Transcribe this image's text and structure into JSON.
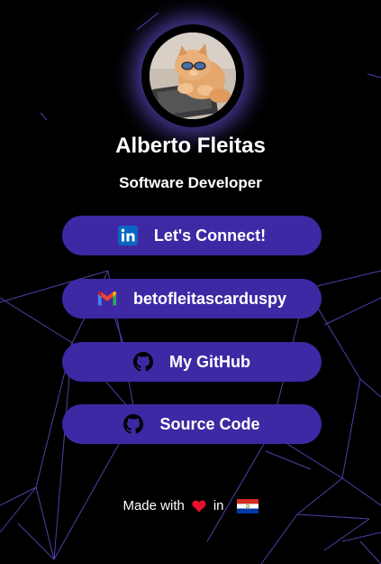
{
  "profile": {
    "name": "Alberto Fleitas",
    "role": "Software Developer"
  },
  "links": [
    {
      "label": "Let's Connect!",
      "icon": "linkedin-icon"
    },
    {
      "label": "betofleitascarduspy",
      "icon": "gmail-icon"
    },
    {
      "label": "My GitHub",
      "icon": "github-icon"
    },
    {
      "label": "Source Code",
      "icon": "github-icon"
    }
  ],
  "footer": {
    "made_with": "Made with",
    "in": "in",
    "heart_icon": "heart-icon",
    "flag_icon": "paraguay-flag-icon"
  },
  "colors": {
    "background": "#000000",
    "button": "#3f28a4",
    "network_lines": "#6a54e0",
    "glow": "#7a60ff",
    "heart": "#e8112d"
  }
}
